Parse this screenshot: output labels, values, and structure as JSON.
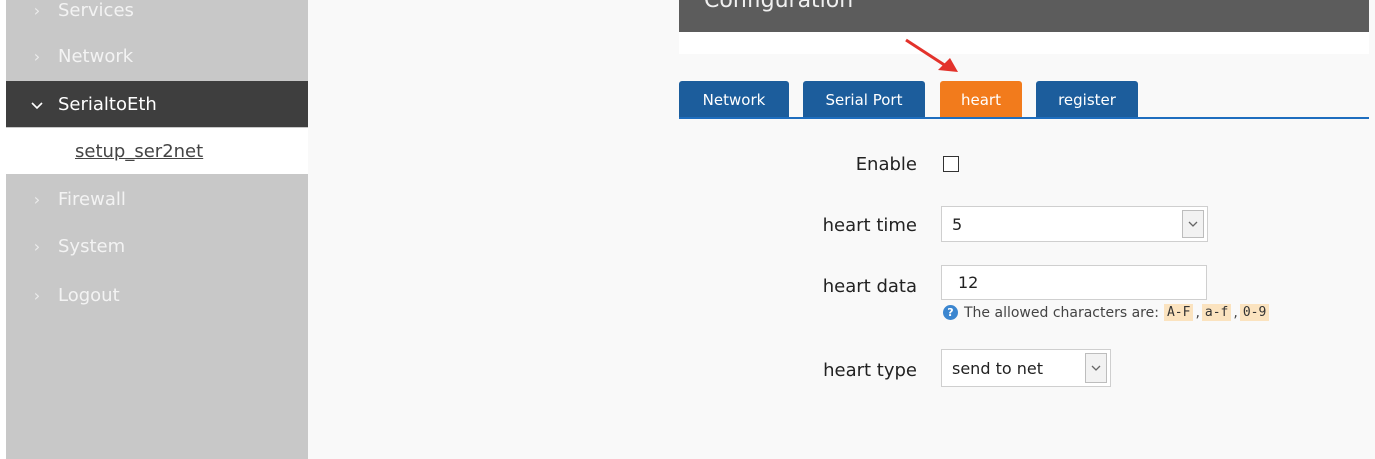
{
  "caption": "... Services ... under the configuration ... (cut off)",
  "sidebar": {
    "items": [
      {
        "label": "Services"
      },
      {
        "label": "Network"
      },
      {
        "label": "SerialtoEth"
      },
      {
        "label": "Firewall"
      },
      {
        "label": "System"
      },
      {
        "label": "Logout"
      }
    ],
    "sub_item": "setup_ser2net"
  },
  "header": {
    "title": "Configuration"
  },
  "tabs": [
    {
      "label": "Network"
    },
    {
      "label": "Serial Port"
    },
    {
      "label": "heart"
    },
    {
      "label": "register"
    }
  ],
  "form": {
    "enable_label": "Enable",
    "heart_time_label": "heart time",
    "heart_time_value": "5",
    "heart_data_label": "heart data",
    "heart_data_value": "12",
    "hint_prefix": "The allowed characters are:",
    "hint_codes": [
      "A-F",
      "a-f",
      "0-9"
    ],
    "hint_sep": ",",
    "heart_type_label": "heart type",
    "heart_type_value": "send to net"
  },
  "colors": {
    "active_tab": "#f27b1c",
    "tab": "#1c5d9c",
    "sidebar": "#c8c8c8",
    "sidebar_active": "#3e3e3e"
  }
}
